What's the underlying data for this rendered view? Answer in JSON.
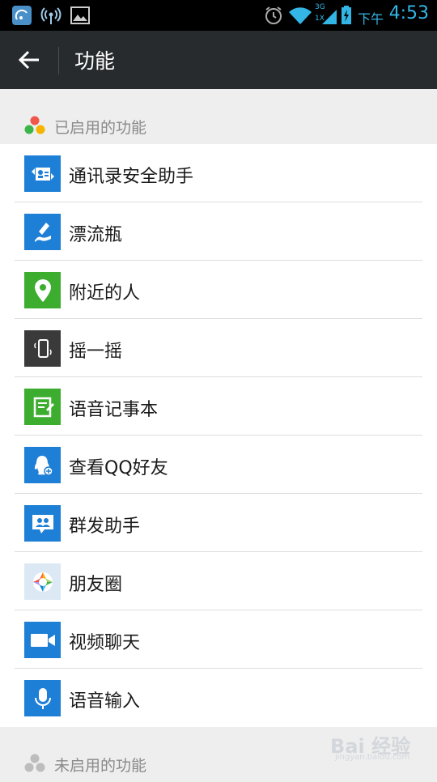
{
  "status_bar": {
    "ampm": "下午",
    "time": "4:53",
    "net_label": "3G",
    "net_sub": "1X"
  },
  "header": {
    "title": "功能"
  },
  "enabled_section": {
    "label": "已启用的功能",
    "items": [
      {
        "label": "通讯录安全助手",
        "color": "#1e7fd6",
        "icon": "contacts-sync-icon"
      },
      {
        "label": "漂流瓶",
        "color": "#1e7fd6",
        "icon": "drift-bottle-icon"
      },
      {
        "label": "附近的人",
        "color": "#3cad2f",
        "icon": "location-pin-icon"
      },
      {
        "label": "摇一摇",
        "color": "#3a3a3a",
        "icon": "shake-phone-icon"
      },
      {
        "label": "语音记事本",
        "color": "#3cad2f",
        "icon": "voice-notepad-icon"
      },
      {
        "label": "查看QQ好友",
        "color": "#1e7fd6",
        "icon": "qq-friends-icon"
      },
      {
        "label": "群发助手",
        "color": "#1e7fd6",
        "icon": "broadcast-icon"
      },
      {
        "label": "朋友圈",
        "color": "#dce9f5",
        "icon": "moments-icon"
      },
      {
        "label": "视频聊天",
        "color": "#1e7fd6",
        "icon": "video-camera-icon"
      },
      {
        "label": "语音输入",
        "color": "#1e7fd6",
        "icon": "microphone-icon"
      }
    ]
  },
  "disabled_section": {
    "label": "未启用的功能"
  },
  "watermark": {
    "text": "Bai 经验",
    "sub": "jingyan.baidu.com"
  }
}
